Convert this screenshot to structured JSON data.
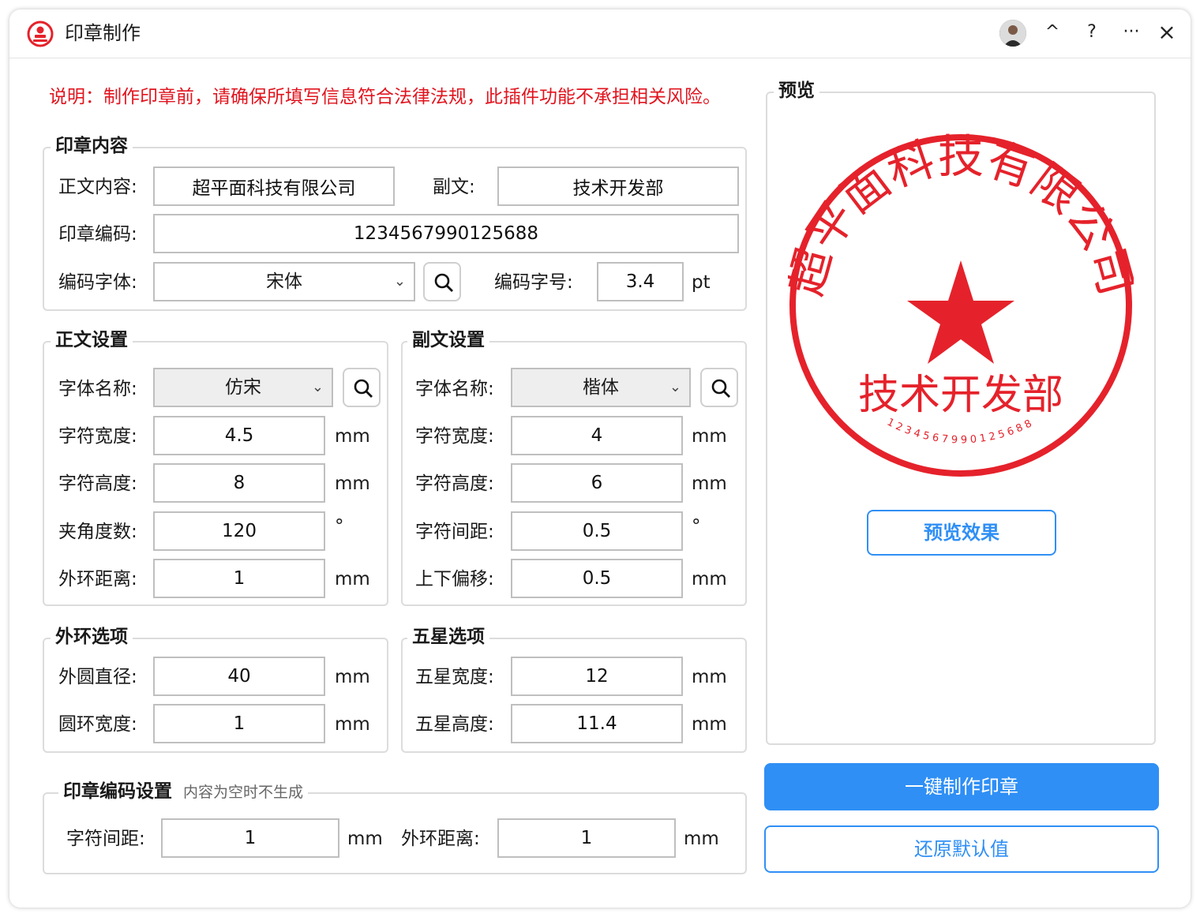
{
  "window": {
    "title": "印章制作",
    "controls": {
      "collapse": "^",
      "help": "?",
      "more": "···",
      "close": "×"
    }
  },
  "notice": "说明：制作印章前，请确保所填写信息符合法律法规，此插件功能不承担相关风险。",
  "content": {
    "legend": "印章内容",
    "main_text_label": "正文内容:",
    "main_text_value": "超平面科技有限公司",
    "sub_text_label": "副文:",
    "sub_text_value": "技术开发部",
    "code_label": "印章编码:",
    "code_value": "1234567990125688",
    "code_font_label": "编码字体:",
    "code_font_value": "宋体",
    "code_size_label": "编码字号:",
    "code_size_value": "3.4",
    "code_size_unit": "pt"
  },
  "main_settings": {
    "legend": "正文设置",
    "font_label": "字体名称:",
    "font_value": "仿宋",
    "width_label": "字符宽度:",
    "width_value": "4.5",
    "width_unit": "mm",
    "height_label": "字符高度:",
    "height_value": "8",
    "height_unit": "mm",
    "angle_label": "夹角度数:",
    "angle_value": "120",
    "angle_unit": "°",
    "ring_dist_label": "外环距离:",
    "ring_dist_value": "1",
    "ring_dist_unit": "mm"
  },
  "sub_settings": {
    "legend": "副文设置",
    "font_label": "字体名称:",
    "font_value": "楷体",
    "width_label": "字符宽度:",
    "width_value": "4",
    "width_unit": "mm",
    "height_label": "字符高度:",
    "height_value": "6",
    "height_unit": "mm",
    "spacing_label": "字符间距:",
    "spacing_value": "0.5",
    "spacing_unit": "°",
    "offset_label": "上下偏移:",
    "offset_value": "0.5",
    "offset_unit": "mm"
  },
  "ring": {
    "legend": "外环选项",
    "diameter_label": "外圆直径:",
    "diameter_value": "40",
    "diameter_unit": "mm",
    "width_label": "圆环宽度:",
    "width_value": "1",
    "width_unit": "mm"
  },
  "star": {
    "legend": "五星选项",
    "width_label": "五星宽度:",
    "width_value": "12",
    "width_unit": "mm",
    "height_label": "五星高度:",
    "height_value": "11.4",
    "height_unit": "mm"
  },
  "code_settings": {
    "legend": "印章编码设置",
    "hint": "内容为空时不生成",
    "spacing_label": "字符间距:",
    "spacing_value": "1",
    "spacing_unit": "mm",
    "ring_dist_label": "外环距离:",
    "ring_dist_value": "1",
    "ring_dist_unit": "mm"
  },
  "preview": {
    "legend": "预览",
    "seal_text": "超平面科技有限公司",
    "seal_sub": "技术开发部",
    "seal_code": "1234567990125688",
    "seal_color": "#e5222b",
    "preview_button": "预览效果"
  },
  "actions": {
    "make_button": "一键制作印章",
    "reset_button": "还原默认值"
  },
  "colors": {
    "accent": "#2f8ff5",
    "warning": "#e1141e"
  }
}
